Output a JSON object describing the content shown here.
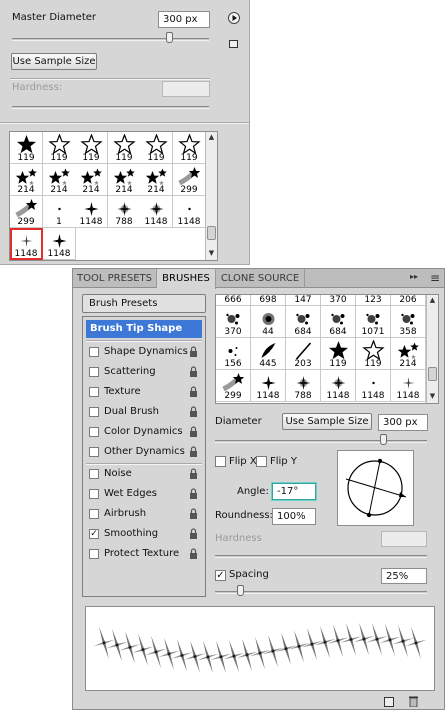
{
  "picker": {
    "master_diameter_label": "Master Diameter",
    "master_diameter_value": "300 px",
    "use_sample_size": "Use Sample Size",
    "hardness_label": "Hardness:",
    "presets": [
      {
        "num": "119",
        "tip": "star-solid"
      },
      {
        "num": "119",
        "tip": "star-outline"
      },
      {
        "num": "119",
        "tip": "star-outline"
      },
      {
        "num": "119",
        "tip": "star-outline"
      },
      {
        "num": "119",
        "tip": "star-outline"
      },
      {
        "num": "119",
        "tip": "star-outline"
      },
      {
        "num": "214",
        "tip": "star-group"
      },
      {
        "num": "214",
        "tip": "star-group"
      },
      {
        "num": "214",
        "tip": "star-group"
      },
      {
        "num": "214",
        "tip": "star-group"
      },
      {
        "num": "214",
        "tip": "star-group"
      },
      {
        "num": "299",
        "tip": "star-comet"
      },
      {
        "num": "299",
        "tip": "star-comet"
      },
      {
        "num": "1",
        "tip": "dot-small"
      },
      {
        "num": "1148",
        "tip": "sparkle"
      },
      {
        "num": "788",
        "tip": "sparkle-soft"
      },
      {
        "num": "1148",
        "tip": "sparkle-soft"
      },
      {
        "num": "1148",
        "tip": "dot-small"
      },
      {
        "num": "1148",
        "tip": "sparkle-thin",
        "selected": true
      },
      {
        "num": "1148",
        "tip": "sparkle"
      }
    ]
  },
  "brushes": {
    "tabs": [
      "TOOL PRESETS",
      "BRUSHES",
      "CLONE SOURCE"
    ],
    "brush_presets_button": "Brush Presets",
    "options": [
      {
        "label": "Brush Tip Shape",
        "selected": true
      },
      {
        "label": "Shape Dynamics",
        "checked": false
      },
      {
        "label": "Scattering",
        "checked": false
      },
      {
        "label": "Texture",
        "checked": false
      },
      {
        "label": "Dual Brush",
        "checked": false
      },
      {
        "label": "Color Dynamics",
        "checked": false
      },
      {
        "label": "Other Dynamics",
        "checked": false
      },
      {
        "label": "Noise",
        "checked": false
      },
      {
        "label": "Wet Edges",
        "checked": false
      },
      {
        "label": "Airbrush",
        "checked": false
      },
      {
        "label": "Smoothing",
        "checked": true
      },
      {
        "label": "Protect Texture",
        "checked": false
      }
    ],
    "tips_row1_nums": [
      "666",
      "698",
      "147",
      "370",
      "123",
      "206"
    ],
    "tips": [
      {
        "num": "370",
        "tip": "splatter"
      },
      {
        "num": "44",
        "tip": "dot-soft"
      },
      {
        "num": "684",
        "tip": "splatter"
      },
      {
        "num": "684",
        "tip": "splatter"
      },
      {
        "num": "1071",
        "tip": "splatter"
      },
      {
        "num": "358",
        "tip": "splatter"
      },
      {
        "num": "156",
        "tip": "dots"
      },
      {
        "num": "445",
        "tip": "leaf"
      },
      {
        "num": "203",
        "tip": "stroke"
      },
      {
        "num": "119",
        "tip": "star-solid"
      },
      {
        "num": "119",
        "tip": "star-outline"
      },
      {
        "num": "214",
        "tip": "star-group"
      },
      {
        "num": "299",
        "tip": "star-comet"
      },
      {
        "num": "1148",
        "tip": "sparkle"
      },
      {
        "num": "788",
        "tip": "sparkle-soft"
      },
      {
        "num": "1148",
        "tip": "sparkle-soft"
      },
      {
        "num": "1148",
        "tip": "dot-small"
      },
      {
        "num": "1148",
        "tip": "sparkle-thin"
      }
    ],
    "diameter_label": "Diameter",
    "use_sample_size": "Use Sample Size",
    "diameter_value": "300 px",
    "flip_x_label": "Flip X",
    "flip_y_label": "Flip Y",
    "angle_label": "Angle:",
    "angle_value": "-17°",
    "roundness_label": "Roundness:",
    "roundness_value": "100%",
    "hardness_label": "Hardness",
    "spacing_label": "Spacing",
    "spacing_checked": true,
    "spacing_value": "25%",
    "smoothing_check": "✓",
    "spacing_check": "✓",
    "menu_glyph": "▸▸",
    "menu_lines_glyph": "≡"
  }
}
